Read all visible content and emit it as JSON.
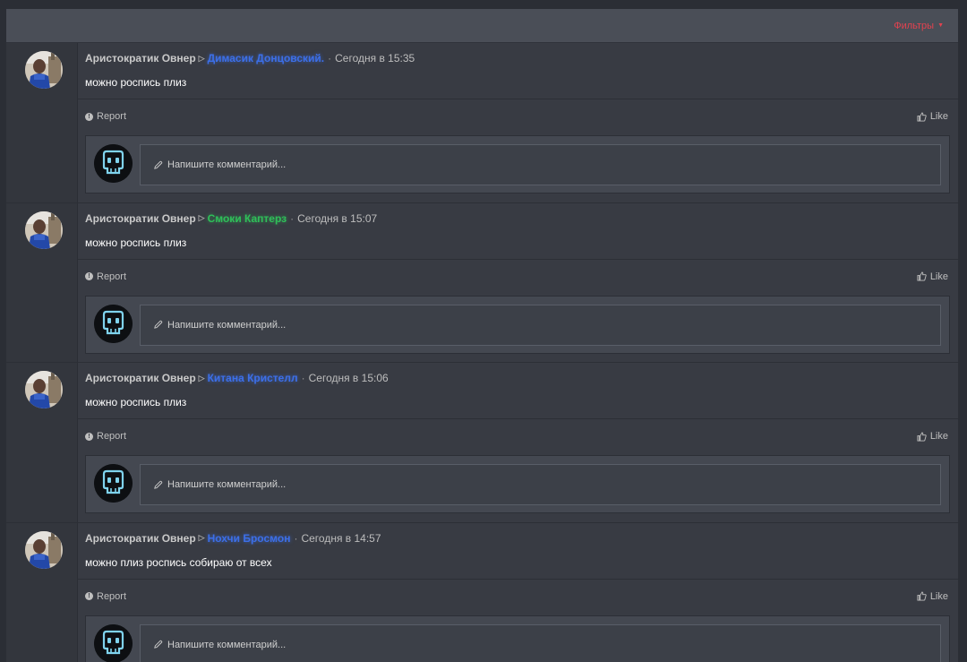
{
  "filter": {
    "label": "Фильтры"
  },
  "common": {
    "report_label": "Report",
    "like_label": "Like",
    "comment_placeholder": "Напишите комментарий..."
  },
  "posts": [
    {
      "author": "Аристократик Овнер",
      "recipient": "Димасик Донцовский.",
      "recipient_color": "#3c6fe8",
      "time": "Сегодня в 15:35",
      "message": "можно роспись плиз"
    },
    {
      "author": "Аристократик Овнер",
      "recipient": "Смоки Каптерз",
      "recipient_color": "#2fbf59",
      "time": "Сегодня в 15:07",
      "message": "можно роспись плиз"
    },
    {
      "author": "Аристократик Овнер",
      "recipient": "Китана Кристелл",
      "recipient_color": "#3c6fe8",
      "time": "Сегодня в 15:06",
      "message": "можно роспись плиз"
    },
    {
      "author": "Аристократик Овнер",
      "recipient": "Нохчи Бросмон",
      "recipient_color": "#3c6fe8",
      "time": "Сегодня в 14:57",
      "message": "можно плиз роспись собираю от всех"
    }
  ]
}
